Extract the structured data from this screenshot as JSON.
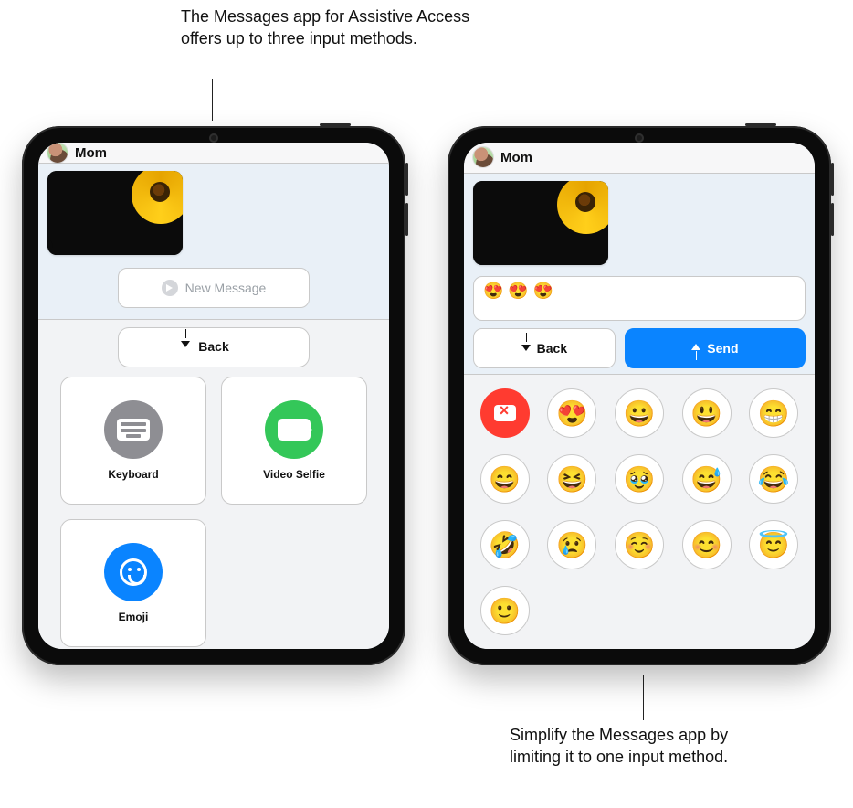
{
  "callouts": {
    "top": "The Messages app for Assistive Access offers up to three input methods.",
    "bottom": "Simplify the Messages app by limiting it to one input method."
  },
  "left": {
    "header": {
      "contact": "Mom"
    },
    "newMessage": {
      "label": "New Message"
    },
    "panel": {
      "back": "Back",
      "tiles": {
        "keyboard": "Keyboard",
        "videoSelfie": "Video Selfie",
        "emoji": "Emoji"
      }
    }
  },
  "right": {
    "header": {
      "contact": "Mom"
    },
    "compose": {
      "value": "😍 😍 😍"
    },
    "actions": {
      "back": "Back",
      "send": "Send"
    },
    "emojiGrid": [
      "😍",
      "😀",
      "😃",
      "😁",
      "😄",
      "😆",
      "🥹",
      "😅",
      "😂",
      "🤣",
      "😢",
      "☺️",
      "😊",
      "😇",
      "🙂"
    ]
  },
  "colors": {
    "brandBlue": "#0a84ff",
    "brandGreen": "#34c759",
    "brandRed": "#ff3b30"
  }
}
